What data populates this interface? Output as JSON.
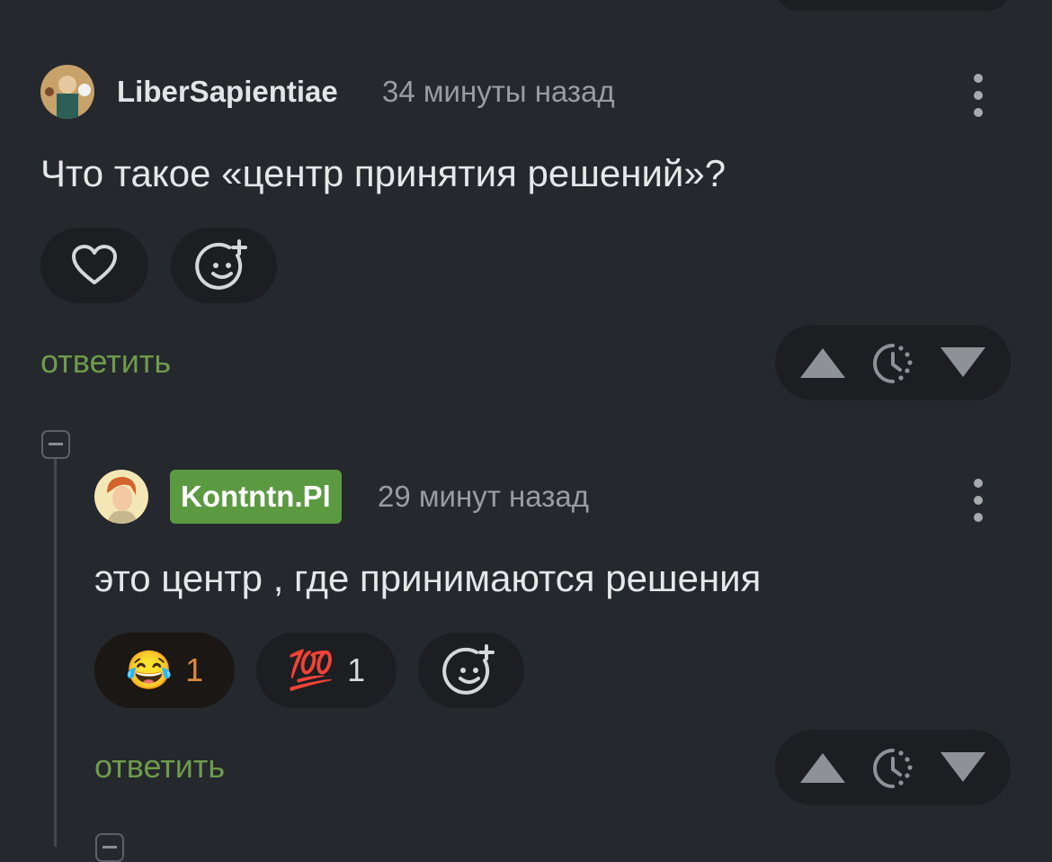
{
  "comments": [
    {
      "username": "LiberSapientiae",
      "time": "34 минуты назад",
      "text": "Что такое «центр принятия решений»?",
      "reply_label": "ответить",
      "reactions": []
    },
    {
      "username": "Kontntn.Pl",
      "time": "29 минут назад",
      "text": "это центр , где принимаются решения",
      "reply_label": "ответить",
      "reactions": [
        {
          "emoji": "😂",
          "count": "1"
        },
        {
          "emoji": "💯",
          "count": "1"
        }
      ]
    }
  ],
  "colors": {
    "background": "#25282d",
    "pill": "#1c1e22",
    "reply_green": "#6f9b4c",
    "badge_green": "#5c9a42",
    "reaction_count_orange": "#d98a3e"
  },
  "icons": {
    "like": "heart-icon",
    "add_reaction": "smile-plus-icon",
    "upvote": "triangle-up-icon",
    "later": "clock-icon",
    "downvote": "triangle-down-icon",
    "menu": "vertical-dots-icon",
    "collapse": "minus-box-icon"
  }
}
